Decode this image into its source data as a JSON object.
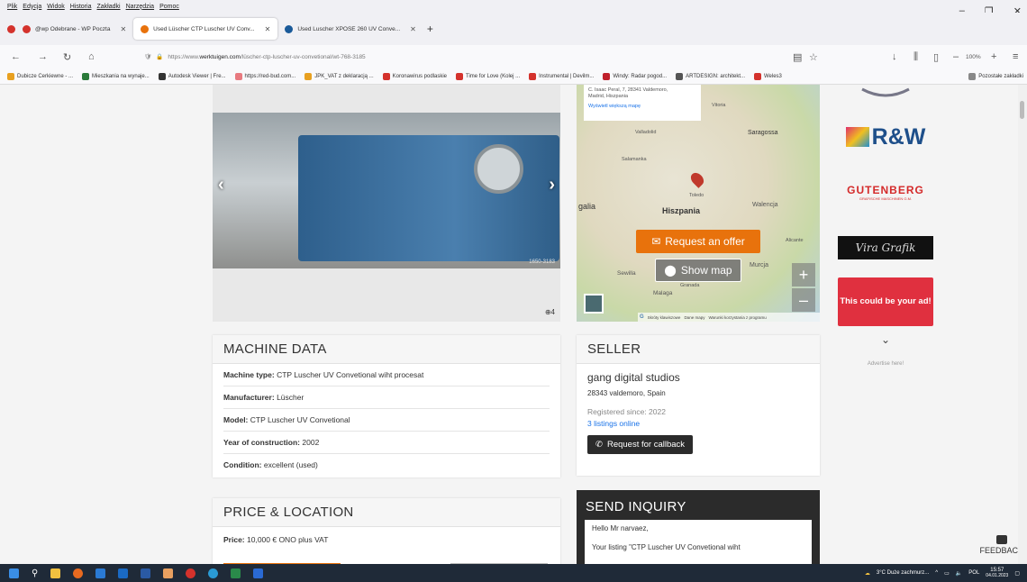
{
  "browser": {
    "menu": [
      "Plik",
      "Edycja",
      "Widok",
      "Historia",
      "Zakładki",
      "Narzędzia",
      "Pomoc"
    ],
    "tabs": [
      {
        "label": "@wp Odebrane - WP Poczta",
        "color": "#d4322c"
      },
      {
        "label": "Used Lüscher CTP Luscher UV Conv...",
        "color": "#e8720c"
      },
      {
        "label": "Used Luscher XPOSE 260 UV Conve...",
        "color": "#1a5a99"
      }
    ],
    "url_prefix": "https://www.",
    "url_domain": "werktuigen.com",
    "url_path": "/lüscher-ctp-luscher-uv-convetional/wt-768-3185",
    "zoom": "100%",
    "bookmarks": [
      {
        "label": "Dubicze Cerkiewne - ...",
        "color": "#e8a020"
      },
      {
        "label": "Mieszkania na wynaje...",
        "color": "#2a7a3a"
      },
      {
        "label": "Autodesk Viewer | Fre...",
        "color": "#333"
      },
      {
        "label": "https://red-bud.com...",
        "color": "#e87a80"
      },
      {
        "label": "JPK_VAT z deklaracją ...",
        "color": "#e8a020"
      },
      {
        "label": "Koronawirus podlaskie",
        "color": "#d4322c"
      },
      {
        "label": "Time for Love (Kolej ...",
        "color": "#d4322c"
      },
      {
        "label": "Instrumental | Devilm...",
        "color": "#d4322c"
      },
      {
        "label": "Windy: Radar pogod...",
        "color": "#c0202c"
      },
      {
        "label": "ARTDESIGN: architekt...",
        "color": "#555"
      },
      {
        "label": "Weles3",
        "color": "#d4322c"
      },
      {
        "label": "Pozostałe zakładki",
        "color": "#888"
      }
    ]
  },
  "gallery": {
    "photo_count": "4",
    "photo_text": "1650-3183"
  },
  "map": {
    "address_line1": "C. Isaac Peral, 7, 28341 Valdemoro,",
    "address_line2": "Madrid, Hiszpania",
    "larger_map": "Wyświetl większą mapę",
    "labels": {
      "zaragoza": "Saragossa",
      "spain": "Hiszpania",
      "valencia": "Walencja",
      "galicia": "galia",
      "murcia": "Murcja",
      "sevilla": "Sewilla",
      "malaga": "Malaga",
      "vitoria": "Vitoria",
      "valladolid": "Valladolid",
      "toledo": "Toledo",
      "salamanca": "Salamanka",
      "granada": "Granada",
      "alicante": "Alicante"
    },
    "request_offer": "Request an offer",
    "show_map": "Show map",
    "footer": [
      "Skróty klawiszowe",
      "Dane mapy",
      "Warunki korzystania z programu"
    ]
  },
  "machine_data": {
    "title": "MACHINE DATA",
    "rows": [
      {
        "label": "Machine type:",
        "value": "CTP Luscher UV Convetional wiht procesat"
      },
      {
        "label": "Manufacturer:",
        "value": "Lüscher"
      },
      {
        "label": "Model:",
        "value": "CTP Luscher UV Convetional"
      },
      {
        "label": "Year of construction:",
        "value": "2002"
      },
      {
        "label": "Condition:",
        "value": "excellent (used)"
      }
    ]
  },
  "price": {
    "title": "PRICE & LOCATION",
    "label": "Price:",
    "value": "10,000 € ONO plus VAT"
  },
  "seller": {
    "title": "SELLER",
    "name": "gang digital studios",
    "location": "28343 valdemoro, Spain",
    "registered": "Registered since: 2022",
    "listings": "3 listings online",
    "callback": "Request for callback"
  },
  "inquiry": {
    "title": "SEND INQUIRY",
    "greeting": "Hello Mr narvaez,",
    "body": "Your listing \"CTP Luscher UV Convetional wiht"
  },
  "ads": {
    "rw": "R&W",
    "gutenberg": "GUTENBERG",
    "gutenberg_sub": "GRAFISCHE MASCHINEN G.M.",
    "vira": "Vira Grafik",
    "red_ad": "This could be your ad!",
    "advertise": "Advertise here!"
  },
  "feedback": "FEEDBACK",
  "taskbar": {
    "weather": "3°C Duże zachmurz...",
    "lang": "POL",
    "time": "15:57",
    "date": "04.01.2023"
  }
}
